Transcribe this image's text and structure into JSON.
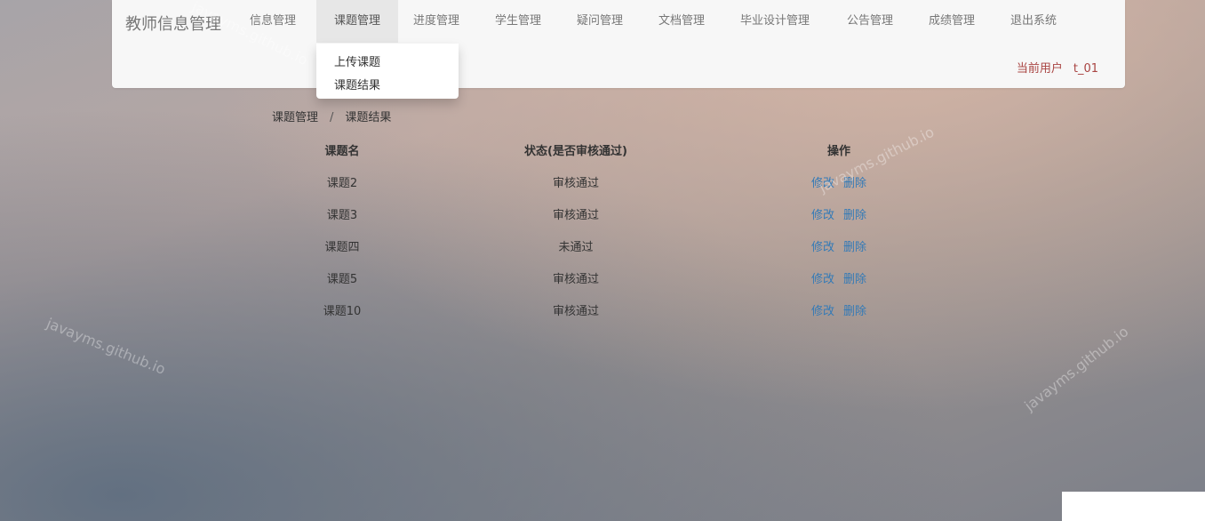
{
  "navbar": {
    "brand": "教师信息管理",
    "items": [
      {
        "label": "信息管理"
      },
      {
        "label": "课题管理"
      },
      {
        "label": "进度管理"
      },
      {
        "label": "学生管理"
      },
      {
        "label": "疑问管理"
      },
      {
        "label": "文档管理"
      },
      {
        "label": "毕业设计管理"
      },
      {
        "label": "公告管理"
      },
      {
        "label": "成绩管理"
      },
      {
        "label": "退出系统"
      }
    ],
    "active_item": "课题管理",
    "current_user_label": "当前用户",
    "current_user_name": "t_01"
  },
  "dropdown": {
    "items": [
      {
        "label": "上传课题"
      },
      {
        "label": "课题结果"
      }
    ]
  },
  "breadcrumb": {
    "items": [
      "课题管理",
      "课题结果"
    ],
    "separator": "/"
  },
  "table": {
    "headers": [
      "课题名",
      "状态(是否审核通过)",
      "操作"
    ],
    "rows": [
      {
        "name": "课题2",
        "status": "审核通过",
        "edit": "修改",
        "delete": "删除"
      },
      {
        "name": "课题3",
        "status": "审核通过",
        "edit": "修改",
        "delete": "删除"
      },
      {
        "name": "课题四",
        "status": "未通过",
        "edit": "修改",
        "delete": "删除"
      },
      {
        "name": "课题5",
        "status": "审核通过",
        "edit": "修改",
        "delete": "删除"
      },
      {
        "name": "课题10",
        "status": "审核通过",
        "edit": "修改",
        "delete": "删除"
      }
    ]
  },
  "watermark": {
    "text": "javayms.github.io"
  },
  "colors": {
    "navbar_bg": "#f7f7f7",
    "active_bg": "#e7e7e7",
    "user_text": "#a94442",
    "link": "#337ab7"
  }
}
